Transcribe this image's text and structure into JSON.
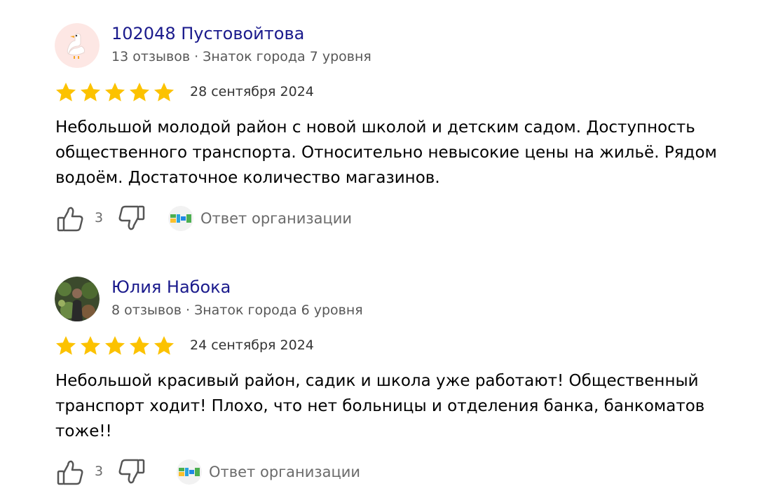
{
  "reviews": [
    {
      "author": "102048 Пустовойтова",
      "meta": "13 отзывов · Знаток города 7 уровня",
      "avatar": "goose-avatar",
      "rating": 5,
      "rating_max": 5,
      "date": "28 сентября 2024",
      "text": "Небольшой молодой район с новой школой и детским садом. Доступность общественного транспорта. Относительно невысокие цены на жильё. Рядом водоём. Достаточное количество магазинов.",
      "likes": "3",
      "org_answer_label": "Ответ организации"
    },
    {
      "author": "Юлия Набока",
      "meta": "8 отзывов · Знаток города 6 уровня",
      "avatar": "photo-avatar",
      "rating": 5,
      "rating_max": 5,
      "date": "24 сентября 2024",
      "text": "Небольшой красивый район, садик и школа уже работают! Общественный транспорт ходит! Плохо, что нет больницы и отделения банка, банкоматов тоже!!",
      "likes": "3",
      "org_answer_label": "Ответ организации"
    }
  ],
  "colors": {
    "author_link": "#1a1a8c",
    "star": "#fcc200",
    "muted": "#6b6b6b"
  },
  "icons": {
    "like": "thumb-up-icon",
    "dislike": "thumb-down-icon",
    "org": "org-logo-icon",
    "star": "star-icon"
  }
}
